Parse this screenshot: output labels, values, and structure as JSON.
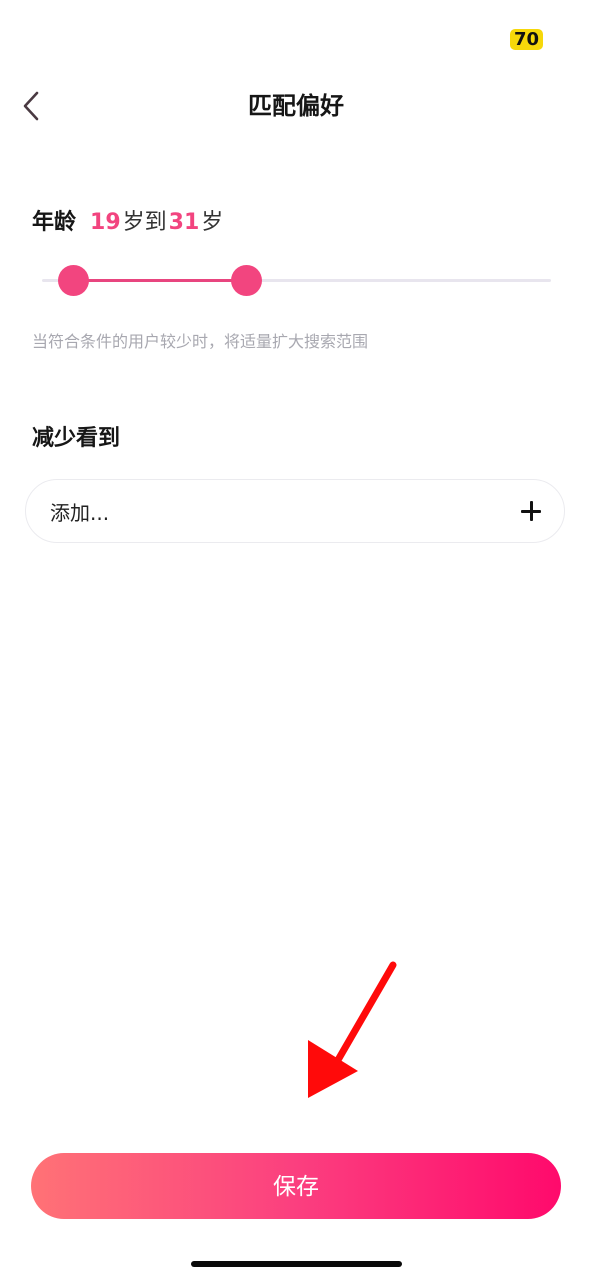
{
  "status_bar": {
    "battery_level": "70",
    "battery_color": "#f6d80a"
  },
  "header": {
    "back_icon": "chevron-left-icon",
    "title": "匹配偏好"
  },
  "age": {
    "label": "年龄",
    "min": "19",
    "min_unit": "岁到",
    "max": "31",
    "max_unit": "岁",
    "accent_color": "#f2447f",
    "slider_min_fraction": 0.06,
    "slider_max_fraction": 0.4
  },
  "hint": "当符合条件的用户较少时，将适量扩大搜索范围",
  "reduce_section": {
    "title": "减少看到",
    "add_label": "添加...",
    "add_icon": "plus-icon"
  },
  "annotation": {
    "icon": "red-arrow-icon",
    "color": "#ff0a0a"
  },
  "save_button": {
    "label": "保存",
    "gradient_start": "#ff7276",
    "gradient_end": "#ff0a6c"
  }
}
